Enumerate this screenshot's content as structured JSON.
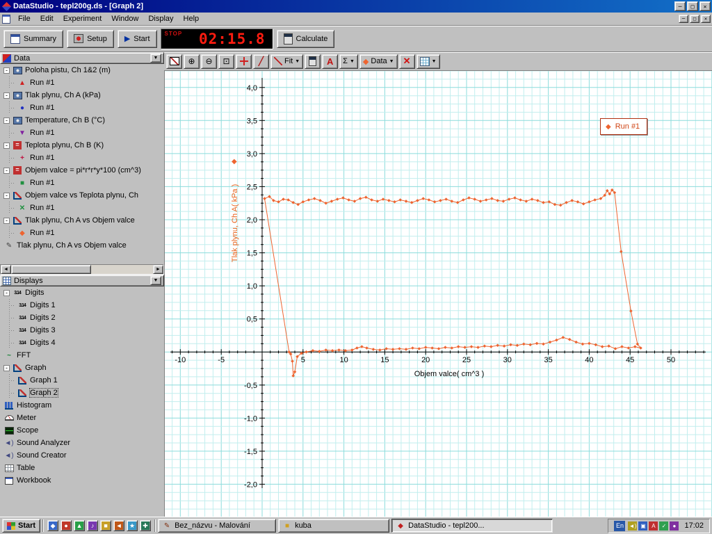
{
  "window": {
    "title": "DataStudio - tepl200g.ds - [Graph 2]"
  },
  "icons": {
    "minimize": "─",
    "restore": "□",
    "close": "✕",
    "menu_arrow": "▼",
    "dropdown_arrow": "▼",
    "play": "▶",
    "diamond": "◆",
    "sigma": "Σ",
    "text_tool": "A",
    "zoom_in": "⊕",
    "zoom_out": "⊖",
    "zoom_select": "⊡",
    "slope": "╱",
    "remove": "✕",
    "left": "◄",
    "right": "►"
  },
  "menu": {
    "items": [
      "File",
      "Edit",
      "Experiment",
      "Window",
      "Display",
      "Help"
    ]
  },
  "toolbar": {
    "summary": "Summary",
    "setup": "Setup",
    "start": "Start",
    "timer_stop": "STOP",
    "timer_value": "02:15.8",
    "calculate": "Calculate"
  },
  "graph_toolbar": {
    "fit": "Fit",
    "data": "Data"
  },
  "data_panel": {
    "title": "Data",
    "rows": [
      {
        "label": "Poloha pistu, Ch 1&2 (m)",
        "icon": "sensor-icon",
        "depth": 0,
        "expander": true
      },
      {
        "label": "Run #1",
        "icon": "marker-triangle-up",
        "depth": 1
      },
      {
        "label": "Tlak plynu, Ch A (kPa)",
        "icon": "sensor-icon",
        "depth": 0,
        "expander": true
      },
      {
        "label": "Run #1",
        "icon": "marker-circle",
        "depth": 1
      },
      {
        "label": "Temperature, Ch B (°C)",
        "icon": "sensor-icon",
        "depth": 0,
        "expander": true
      },
      {
        "label": "Run #1",
        "icon": "marker-triangle-down",
        "depth": 1
      },
      {
        "label": "Teplota plynu, Ch B (K)",
        "icon": "calc-data-icon",
        "depth": 0,
        "expander": true
      },
      {
        "label": "Run #1",
        "icon": "marker-plus",
        "depth": 1
      },
      {
        "label": "Objem valce = pi*r*r*y*100 (cm^3)",
        "icon": "calc-data-icon",
        "depth": 0,
        "expander": true
      },
      {
        "label": "Run #1",
        "icon": "marker-square",
        "depth": 1
      },
      {
        "label": "Objem valce vs Teplota plynu, Ch",
        "icon": "graph-data-icon",
        "depth": 0,
        "expander": true
      },
      {
        "label": "Run #1",
        "icon": "marker-x",
        "depth": 1
      },
      {
        "label": "Tlak plynu, Ch A vs Objem valce",
        "icon": "graph-data-icon",
        "depth": 0,
        "expander": true
      },
      {
        "label": "Run #1",
        "icon": "marker-diamond",
        "depth": 1
      },
      {
        "label": "Tlak plynu, Ch A vs Objem valce",
        "icon": "pen-icon",
        "depth": 0,
        "expander": false
      }
    ]
  },
  "displays_panel": {
    "title": "Displays",
    "rows": [
      {
        "label": "Digits",
        "icon": "digits-icon",
        "depth": 0,
        "expander": true
      },
      {
        "label": "Digits 1",
        "icon": "digits-icon",
        "depth": 1
      },
      {
        "label": "Digits 2",
        "icon": "digits-icon",
        "depth": 1
      },
      {
        "label": "Digits 3",
        "icon": "digits-icon",
        "depth": 1
      },
      {
        "label": "Digits 4",
        "icon": "digits-icon",
        "depth": 1
      },
      {
        "label": "FFT",
        "icon": "fft-icon",
        "depth": 0
      },
      {
        "label": "Graph",
        "icon": "graph-icon",
        "depth": 0,
        "expander": true
      },
      {
        "label": "Graph 1",
        "icon": "graph-icon",
        "depth": 1
      },
      {
        "label": "Graph 2",
        "icon": "graph-icon",
        "depth": 1,
        "selected": true
      },
      {
        "label": "Histogram",
        "icon": "histogram-icon",
        "depth": 0
      },
      {
        "label": "Meter",
        "icon": "meter-icon",
        "depth": 0
      },
      {
        "label": "Scope",
        "icon": "scope-icon",
        "depth": 0
      },
      {
        "label": "Sound Analyzer",
        "icon": "sound-icon",
        "depth": 0
      },
      {
        "label": "Sound Creator",
        "icon": "sound-icon",
        "depth": 0
      },
      {
        "label": "Table",
        "icon": "table-icon",
        "depth": 0
      },
      {
        "label": "Workbook",
        "icon": "workbook-icon",
        "depth": 0
      }
    ]
  },
  "taskbar": {
    "start": "Start",
    "quick_launch": [
      "quick-launch-icon-1",
      "quick-launch-icon-2",
      "quick-launch-icon-3",
      "quick-launch-icon-4",
      "quick-launch-icon-5",
      "quick-launch-icon-6",
      "quick-launch-icon-7",
      "quick-launch-icon-8"
    ],
    "tasks": [
      {
        "label": "Bez_názvu - Malování",
        "icon": "paint-icon",
        "active": false
      },
      {
        "label": "kuba",
        "icon": "folder-icon",
        "active": false
      },
      {
        "label": "DataStudio - tepl200...",
        "icon": "datastudio-icon",
        "active": true
      }
    ],
    "language": "En",
    "tray_icons": [
      "tray-icon-1",
      "tray-icon-2",
      "tray-icon-3",
      "tray-icon-4",
      "tray-icon-5"
    ],
    "time": "17:02"
  },
  "chart_data": {
    "type": "line",
    "title": "",
    "xlabel": "Objem valce( cm^3 )",
    "ylabel": "Tlak plynu, Ch A( kPa )",
    "xlim": [
      -11.9,
      55.1
    ],
    "ylim": [
      -2.5,
      4.25
    ],
    "x_ticks": [
      -10,
      -5,
      5,
      10,
      15,
      20,
      25,
      30,
      35,
      40,
      45,
      50
    ],
    "x_tick_labels": [
      "-10",
      "-5",
      "5",
      "10",
      "15",
      "20",
      "25",
      "30",
      "35",
      "40",
      "45",
      "50"
    ],
    "y_tick_values": [
      4,
      3.5,
      3,
      2.5,
      2,
      1.5,
      1,
      0.5,
      -0.5,
      -1,
      -1.5,
      -2
    ],
    "y_tick_labels": [
      "4,0",
      "3,5",
      "3,0",
      "2,5",
      "2,0",
      "1,5",
      "1,0",
      "0,5",
      "-0,5",
      "-1,0",
      "-1,5",
      "-2,0"
    ],
    "grid": {
      "minor_x": 1,
      "minor_y": 0.125,
      "major_x": 5,
      "major_y": 0.5
    },
    "legend": {
      "label": "Run #1",
      "position": "top-right"
    },
    "series": [
      {
        "name": "Run #1",
        "color": "#ee6430",
        "marker": "diamond",
        "points": [
          [
            0.3,
            2.32
          ],
          [
            0.9,
            2.35
          ],
          [
            1.4,
            2.29
          ],
          [
            2.0,
            2.27
          ],
          [
            2.6,
            2.31
          ],
          [
            3.2,
            2.3
          ],
          [
            3.8,
            2.26
          ],
          [
            4.4,
            2.23
          ],
          [
            5.0,
            2.27
          ],
          [
            5.7,
            2.3
          ],
          [
            6.4,
            2.32
          ],
          [
            7.1,
            2.29
          ],
          [
            7.8,
            2.25
          ],
          [
            8.5,
            2.28
          ],
          [
            9.2,
            2.31
          ],
          [
            9.9,
            2.33
          ],
          [
            10.6,
            2.3
          ],
          [
            11.3,
            2.28
          ],
          [
            12.0,
            2.32
          ],
          [
            12.7,
            2.34
          ],
          [
            13.4,
            2.3
          ],
          [
            14.1,
            2.28
          ],
          [
            14.8,
            2.31
          ],
          [
            15.5,
            2.29
          ],
          [
            16.2,
            2.27
          ],
          [
            16.9,
            2.3
          ],
          [
            17.6,
            2.28
          ],
          [
            18.3,
            2.26
          ],
          [
            19.0,
            2.29
          ],
          [
            19.7,
            2.32
          ],
          [
            20.4,
            2.3
          ],
          [
            21.1,
            2.27
          ],
          [
            21.8,
            2.29
          ],
          [
            22.5,
            2.31
          ],
          [
            23.2,
            2.28
          ],
          [
            23.9,
            2.26
          ],
          [
            24.6,
            2.3
          ],
          [
            25.3,
            2.33
          ],
          [
            26.0,
            2.31
          ],
          [
            26.7,
            2.28
          ],
          [
            27.4,
            2.3
          ],
          [
            28.1,
            2.32
          ],
          [
            28.8,
            2.29
          ],
          [
            29.5,
            2.28
          ],
          [
            30.2,
            2.31
          ],
          [
            30.9,
            2.33
          ],
          [
            31.6,
            2.3
          ],
          [
            32.3,
            2.28
          ],
          [
            33.0,
            2.31
          ],
          [
            33.7,
            2.29
          ],
          [
            34.4,
            2.26
          ],
          [
            35.1,
            2.27
          ],
          [
            35.8,
            2.23
          ],
          [
            36.5,
            2.22
          ],
          [
            37.2,
            2.26
          ],
          [
            37.9,
            2.29
          ],
          [
            38.6,
            2.27
          ],
          [
            39.3,
            2.24
          ],
          [
            40.0,
            2.27
          ],
          [
            40.7,
            2.3
          ],
          [
            41.4,
            2.32
          ],
          [
            41.9,
            2.37
          ],
          [
            42.2,
            2.44
          ],
          [
            42.5,
            2.39
          ],
          [
            42.8,
            2.45
          ],
          [
            43.1,
            2.41
          ],
          [
            43.9,
            1.52
          ],
          [
            45.1,
            0.62
          ],
          [
            45.9,
            0.12
          ],
          [
            46.3,
            0.06
          ],
          [
            45.6,
            0.08
          ],
          [
            44.8,
            0.06
          ],
          [
            44.0,
            0.08
          ],
          [
            43.2,
            0.05
          ],
          [
            42.4,
            0.09
          ],
          [
            41.6,
            0.08
          ],
          [
            40.8,
            0.11
          ],
          [
            40.0,
            0.13
          ],
          [
            39.2,
            0.12
          ],
          [
            38.4,
            0.15
          ],
          [
            37.6,
            0.19
          ],
          [
            36.8,
            0.22
          ],
          [
            36.0,
            0.18
          ],
          [
            35.2,
            0.15
          ],
          [
            34.4,
            0.12
          ],
          [
            33.6,
            0.13
          ],
          [
            32.8,
            0.11
          ],
          [
            32.0,
            0.12
          ],
          [
            31.2,
            0.1
          ],
          [
            30.4,
            0.11
          ],
          [
            29.6,
            0.09
          ],
          [
            28.8,
            0.1
          ],
          [
            28.0,
            0.08
          ],
          [
            27.2,
            0.09
          ],
          [
            26.4,
            0.07
          ],
          [
            25.6,
            0.08
          ],
          [
            24.8,
            0.07
          ],
          [
            24.0,
            0.08
          ],
          [
            23.2,
            0.06
          ],
          [
            22.4,
            0.07
          ],
          [
            21.6,
            0.05
          ],
          [
            20.8,
            0.06
          ],
          [
            20.0,
            0.07
          ],
          [
            19.2,
            0.05
          ],
          [
            18.4,
            0.06
          ],
          [
            17.6,
            0.04
          ],
          [
            16.8,
            0.05
          ],
          [
            16.0,
            0.04
          ],
          [
            15.2,
            0.05
          ],
          [
            14.4,
            0.03
          ],
          [
            13.6,
            0.04
          ],
          [
            12.8,
            0.06
          ],
          [
            12.2,
            0.08
          ],
          [
            11.6,
            0.06
          ],
          [
            11.0,
            0.03
          ],
          [
            10.2,
            0.02
          ],
          [
            9.4,
            0.03
          ],
          [
            8.6,
            0.02
          ],
          [
            7.8,
            0.03
          ],
          [
            7.0,
            0.01
          ],
          [
            6.2,
            0.02
          ],
          [
            5.4,
            0.0
          ],
          [
            4.8,
            -0.02
          ],
          [
            4.3,
            -0.07
          ],
          [
            4.0,
            -0.3
          ],
          [
            3.8,
            -0.36
          ],
          [
            3.7,
            -0.14
          ],
          [
            3.5,
            -0.03
          ],
          [
            3.3,
            0.0
          ],
          [
            0.3,
            2.32
          ]
        ]
      }
    ]
  }
}
